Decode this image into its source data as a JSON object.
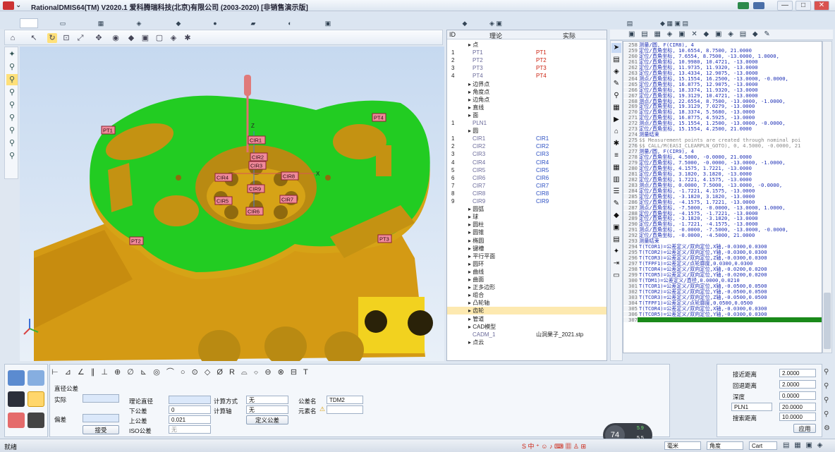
{
  "window": {
    "title": "RationalDMIS64(TM) V2020.1    爱科腾瑞科技(北京)有限公司 (2003-2020) [非销售演示版]",
    "min": "—",
    "max": "□",
    "close": "✕"
  },
  "viewport": {
    "pt_labels": [
      "PT1",
      "PT2",
      "PT3",
      "PT4"
    ],
    "cir_labels": [
      "CIR1",
      "CIR2",
      "CIR3",
      "CIR4",
      "CIR5",
      "CIR6",
      "CIR7",
      "CIR8",
      "CIR9"
    ],
    "axis_z": "Z",
    "axis_x": "X"
  },
  "tree": {
    "headers": {
      "id": "ID",
      "nominal": "理论",
      "actual": "实际"
    },
    "rows": [
      {
        "id": "",
        "name": "点",
        "actual": ""
      },
      {
        "id": "1",
        "name": "PT1",
        "actual": "PT1"
      },
      {
        "id": "2",
        "name": "PT2",
        "actual": "PT2"
      },
      {
        "id": "3",
        "name": "PT3",
        "actual": "PT3"
      },
      {
        "id": "4",
        "name": "PT4",
        "actual": "PT4"
      },
      {
        "id": "",
        "name": "边界点",
        "actual": ""
      },
      {
        "id": "",
        "name": "角度点",
        "actual": ""
      },
      {
        "id": "",
        "name": "边角点",
        "actual": ""
      },
      {
        "id": "",
        "name": "直线",
        "actual": ""
      },
      {
        "id": "",
        "name": "面",
        "actual": ""
      },
      {
        "id": "1",
        "name": "PLN1",
        "actual": ""
      },
      {
        "id": "",
        "name": "圆",
        "actual": ""
      },
      {
        "id": "1",
        "name": "CIR1",
        "actual": "CIR1"
      },
      {
        "id": "2",
        "name": "CIR2",
        "actual": "CIR2"
      },
      {
        "id": "3",
        "name": "CIR3",
        "actual": "CIR3"
      },
      {
        "id": "4",
        "name": "CIR4",
        "actual": "CIR4"
      },
      {
        "id": "5",
        "name": "CIR5",
        "actual": "CIR5"
      },
      {
        "id": "6",
        "name": "CIR6",
        "actual": "CIR6"
      },
      {
        "id": "7",
        "name": "CIR7",
        "actual": "CIR7"
      },
      {
        "id": "8",
        "name": "CIR8",
        "actual": "CIR8"
      },
      {
        "id": "9",
        "name": "CIR9",
        "actual": "CIR9"
      },
      {
        "id": "",
        "name": "圆弧",
        "actual": ""
      },
      {
        "id": "",
        "name": "球",
        "actual": ""
      },
      {
        "id": "",
        "name": "圆柱",
        "actual": ""
      },
      {
        "id": "",
        "name": "圆锥",
        "actual": ""
      },
      {
        "id": "",
        "name": "椭圆",
        "actual": ""
      },
      {
        "id": "",
        "name": "键槽",
        "actual": ""
      },
      {
        "id": "",
        "name": "平行平面",
        "actual": ""
      },
      {
        "id": "",
        "name": "圆环",
        "actual": ""
      },
      {
        "id": "",
        "name": "曲线",
        "actual": ""
      },
      {
        "id": "",
        "name": "曲面",
        "actual": ""
      },
      {
        "id": "",
        "name": "正多边形",
        "actual": ""
      },
      {
        "id": "",
        "name": "组合",
        "actual": ""
      },
      {
        "id": "",
        "name": "凸轮轴",
        "actual": ""
      },
      {
        "id": "",
        "name": "齿轮",
        "actual": ""
      },
      {
        "id": "",
        "name": "管道",
        "actual": ""
      },
      {
        "id": "",
        "name": "CAD模型",
        "actual": ""
      },
      {
        "id": "",
        "name": "CADM_1",
        "actual": "山洞果子_2021.stp"
      },
      {
        "id": "",
        "name": "点云",
        "actual": ""
      }
    ]
  },
  "editor": {
    "lines": [
      {
        "n": "258",
        "t": "测量/圆, F(CIR8), 4",
        "c": "#1d2fb5"
      },
      {
        "n": "259",
        "t": "  定位/直角坐标,   10.6554,  8.7500,  21.0000",
        "c": "#1d2fb5"
      },
      {
        "n": "260",
        "t": "  定位/直角坐标,   7.6554,  8.7500, -13.0000,  1.0000,",
        "c": "#1d2fb5"
      },
      {
        "n": "261",
        "t": "  定位/直角坐标,   10.9980, 10.4721, -13.0000",
        "c": "#1d2fb5"
      },
      {
        "n": "262",
        "t": "  定位/直角坐标,   11.9735, 11.9320, -13.0000",
        "c": "#1d2fb5"
      },
      {
        "n": "263",
        "t": "  定位/直角坐标,   13.4334, 12.9075, -13.0000",
        "c": "#1d2fb5"
      },
      {
        "n": "264",
        "t": "  测点/直角坐标, 15.1554, 16.2500, -13.0000, -0.0000,",
        "c": "#1d2fb5"
      },
      {
        "n": "265",
        "t": "  定位/直角坐标,   16.8775, 12.9075, -13.0000",
        "c": "#1d2fb5"
      },
      {
        "n": "266",
        "t": "  定位/直角坐标,   18.3374, 11.9320, -13.0000",
        "c": "#1d2fb5"
      },
      {
        "n": "267",
        "t": "  定位/直角坐标,   19.3129, 10.4721, -13.0000",
        "c": "#1d2fb5"
      },
      {
        "n": "268",
        "t": "  测点/直角坐标, 22.6554,  8.7500, -13.0000, -1.0000,",
        "c": "#1d2fb5"
      },
      {
        "n": "269",
        "t": "  定位/直角坐标,   19.3129,  7.0279, -13.0000",
        "c": "#1d2fb5"
      },
      {
        "n": "270",
        "t": "  定位/直角坐标,   18.3374,  5.5680, -13.0000",
        "c": "#1d2fb5"
      },
      {
        "n": "271",
        "t": "  定位/直角坐标,   16.8775,  4.5925, -13.0000",
        "c": "#1d2fb5"
      },
      {
        "n": "272",
        "t": "  测点/直角坐标, 15.1554,  1.2500, -13.0000, -0.0000,",
        "c": "#1d2fb5"
      },
      {
        "n": "273",
        "t": "  定位/直角坐标,   15.1554,  4.2500,  21.0000",
        "c": "#1d2fb5"
      },
      {
        "n": "274",
        "t": "测量结束",
        "c": "#1d2fb5"
      },
      {
        "n": "275",
        "t": "$$ Measurement points are created through nominal poi",
        "c": "#888888"
      },
      {
        "n": "276",
        "t": "$$ CALL/M(EASI_CLEARPLN_GOTO), 0, 4.5000, -0.0000, 21",
        "c": "#888888"
      },
      {
        "n": "277",
        "t": "测量/圆, F(CIR9), 4",
        "c": "#1d2fb5"
      },
      {
        "n": "278",
        "t": "  定位/直角坐标,    4.5000, -0.0000,  21.0000",
        "c": "#1d2fb5"
      },
      {
        "n": "279",
        "t": "  定位/直角坐标,    7.5000, -0.0000, -13.0000, -1.0000,",
        "c": "#1d2fb5"
      },
      {
        "n": "280",
        "t": "  定位/直角坐标,    4.1575,  1.7221, -13.0000",
        "c": "#1d2fb5"
      },
      {
        "n": "281",
        "t": "  定位/直角坐标,    3.1820,  3.1820, -13.0000",
        "c": "#1d2fb5"
      },
      {
        "n": "282",
        "t": "  定位/直角坐标,    1.7221,  4.1575, -13.0000",
        "c": "#1d2fb5"
      },
      {
        "n": "283",
        "t": "  测点/直角坐标,  0.0000,  7.5000, -13.0000, -0.0000,",
        "c": "#1d2fb5"
      },
      {
        "n": "284",
        "t": "  定位/直角坐标,   -1.7221,  4.1575, -13.0000",
        "c": "#1d2fb5"
      },
      {
        "n": "285",
        "t": "  定位/直角坐标,   -3.1820,  3.1820, -13.0000",
        "c": "#1d2fb5"
      },
      {
        "n": "286",
        "t": "  定位/直角坐标,   -4.1575,  1.7221, -13.0000",
        "c": "#1d2fb5"
      },
      {
        "n": "287",
        "t": "  测点/直角坐标, -7.5000, -0.0000, -13.0000,  1.0000,",
        "c": "#1d2fb5"
      },
      {
        "n": "288",
        "t": "  定位/直角坐标,   -4.1575, -1.7221, -13.0000",
        "c": "#1d2fb5"
      },
      {
        "n": "289",
        "t": "  定位/直角坐标,   -3.1820, -3.1820, -13.0000",
        "c": "#1d2fb5"
      },
      {
        "n": "290",
        "t": "  定位/直角坐标,   -1.7221, -4.1575, -13.0000",
        "c": "#1d2fb5"
      },
      {
        "n": "291",
        "t": "  测点/直角坐标, -0.0000, -7.5000, -13.0000, -0.0000,",
        "c": "#1d2fb5"
      },
      {
        "n": "292",
        "t": "  定位/直角坐标,   -0.0000, -4.5000,  21.0000",
        "c": "#1d2fb5"
      },
      {
        "n": "293",
        "t": "测量结束",
        "c": "#1d2fb5"
      },
      {
        "n": "294",
        "t": "T(TCOR1)=公差定义/双向定位,X轴,-0.0300,0.0300",
        "c": "#1d2fb5"
      },
      {
        "n": "295",
        "t": "T(TCOR2)=公差定义/双向定位,Y轴,-0.0300,0.0300",
        "c": "#1d2fb5"
      },
      {
        "n": "296",
        "t": "T(TCOR3)=公差定义/双向定位,Z轴,-0.0300,0.0300",
        "c": "#1d2fb5"
      },
      {
        "n": "297",
        "t": "T(TFPF1)=公差定义/点轮廓度,0.0300,0.0300",
        "c": "#1d2fb5"
      },
      {
        "n": "298",
        "t": "T(TCOR4)=公差定义/双向定位,X轴,-0.0200,0.0200",
        "c": "#1d2fb5"
      },
      {
        "n": "299",
        "t": "T(TCOR5)=公差定义/双向定位,Y轴,-0.0200,0.0200",
        "c": "#1d2fb5"
      },
      {
        "n": "300",
        "t": "T(TDM1)=公差定义/直径,0.0000,0.0210",
        "c": "#1d2fb5"
      },
      {
        "n": "301",
        "t": "T(TCOR1)=公差定义/双向定位,X轴,-0.0500,0.0500",
        "c": "#1d2fb5"
      },
      {
        "n": "302",
        "t": "T(TCOR2)=公差定义/双向定位,Y轴,-0.0500,0.0500",
        "c": "#1d2fb5"
      },
      {
        "n": "303",
        "t": "T(TCOR3)=公差定义/双向定位,Z轴,-0.0500,0.0500",
        "c": "#1d2fb5"
      },
      {
        "n": "304",
        "t": "T(TFPF1)=公差定义/点轮廓度,0.0500,0.0500",
        "c": "#1d2fb5"
      },
      {
        "n": "305",
        "t": "T(TCOR4)=公差定义/双向定位,X轴,-0.0300,0.0300",
        "c": "#1d2fb5"
      },
      {
        "n": "306",
        "t": "T(TCOR5)=公差定义/双向定位,Y轴,-0.0300,0.0300",
        "c": "#1d2fb5"
      },
      {
        "n": "307",
        "t": "",
        "c": "#1d2fb5"
      }
    ]
  },
  "tolerance": {
    "title": "直径公差",
    "actual": "实际",
    "deviation": "偏差",
    "accept": "接受",
    "nominal_dia": "理论直径",
    "lower_tol": "下公差",
    "upper_tol": "上公差",
    "iso_tol": "ISO公差",
    "lower_val": "0",
    "upper_val": "0.021",
    "iso_val": "无",
    "calc_mode": "计算方式",
    "calc_mode_val": "无",
    "calc_axis": "计算轴",
    "calc_axis_val": "无",
    "define_tol": "定义公差",
    "tol_name": "公差名",
    "tol_name_val": "TDM2",
    "element_name": "元素名"
  },
  "probe": {
    "approach": "接近距离",
    "approach_val": "2.0000",
    "retract": "回退距离",
    "retract_val": "2.0000",
    "depth": "深度",
    "depth_val": "0.0000",
    "plane": "PLN1",
    "plane_val": "20.0000",
    "search": "搜索距离",
    "search_val": "10.0000",
    "apply": "应用"
  },
  "status": {
    "ready": "就绪",
    "unit": "毫米",
    "angle": "角度",
    "cart": "Cart",
    "speed": "74",
    "net_up": "5.9",
    "net_down": "5.5",
    "net_unit": "K/s"
  }
}
